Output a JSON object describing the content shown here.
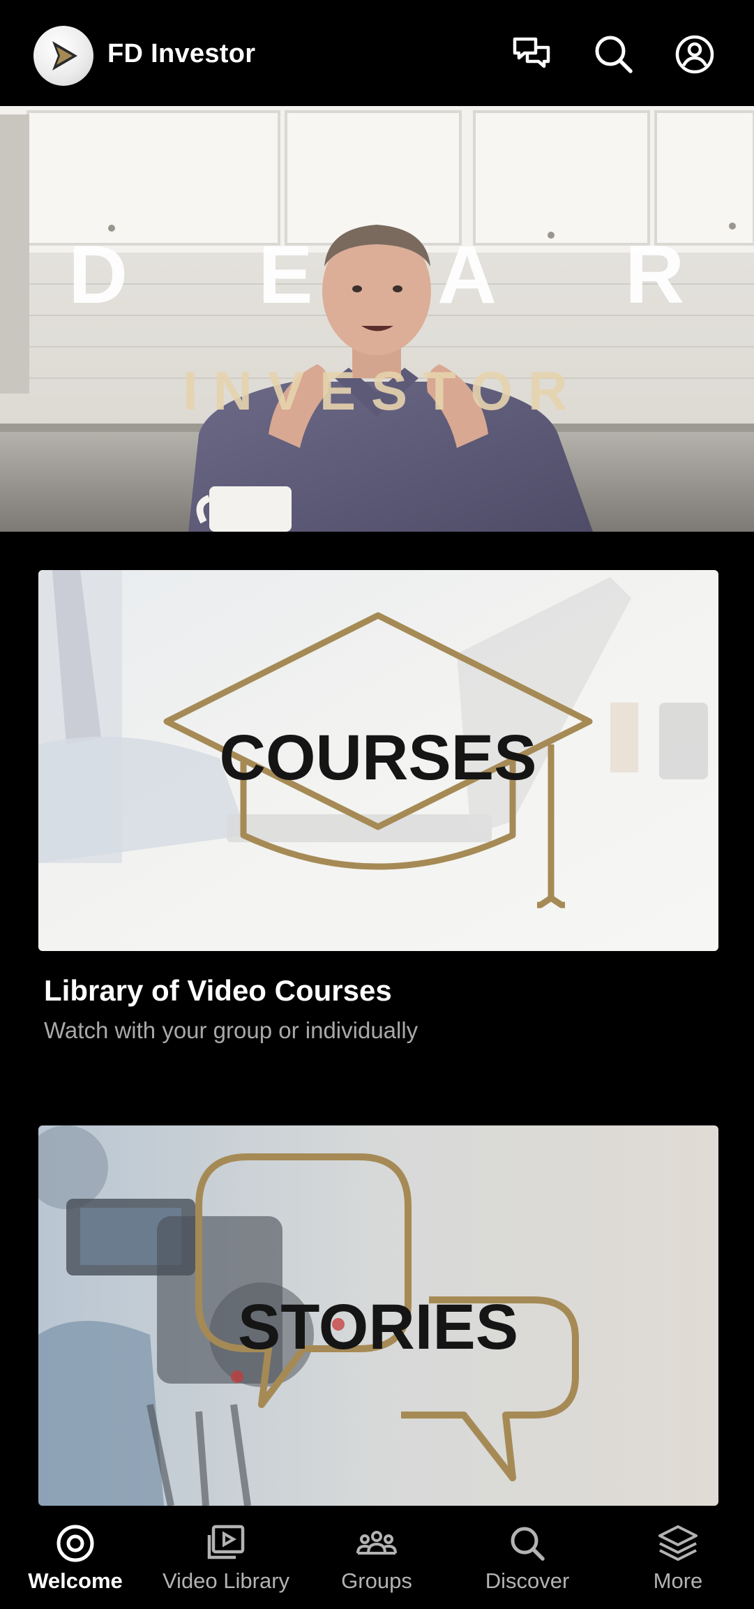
{
  "app": {
    "title": "FD Investor",
    "icons": [
      "chat-bubbles-icon",
      "search-icon",
      "account-circle-icon"
    ]
  },
  "hero": {
    "title_word": "D E A R",
    "subtitle_word": "INVESTOR"
  },
  "cards": [
    {
      "image_text": "COURSES",
      "title": "Library of Video Courses",
      "subtitle": "Watch with your group or individually"
    },
    {
      "image_text": "STORIES"
    }
  ],
  "bottom_nav": {
    "items": [
      {
        "label": "Welcome",
        "icon": "target-icon",
        "active": true
      },
      {
        "label": "Video Library",
        "icon": "video-library-icon",
        "active": false
      },
      {
        "label": "Groups",
        "icon": "groups-icon",
        "active": false
      },
      {
        "label": "Discover",
        "icon": "search-icon",
        "active": false
      },
      {
        "label": "More",
        "icon": "layers-icon",
        "active": false
      }
    ]
  },
  "colors": {
    "background": "#000000",
    "gold_accent": "#a68a55",
    "inactive_nav": "#b3b3b3"
  }
}
